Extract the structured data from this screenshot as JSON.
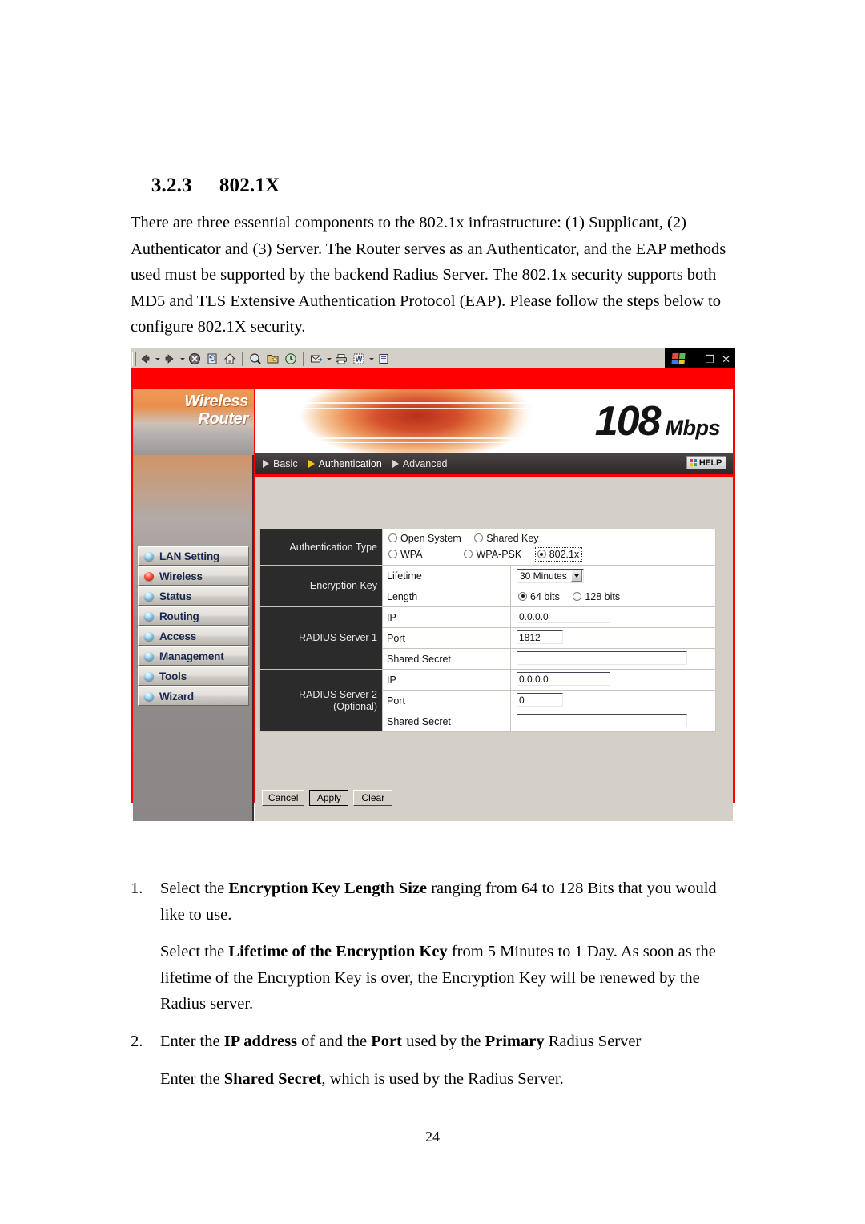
{
  "document": {
    "section_number": "3.2.3",
    "section_title": "802.1X",
    "intro": "There are three essential components to the 802.1x infrastructure: (1) Supplicant, (2) Authenticator and (3) Server.    The Router serves as an Authenticator, and the EAP methods used must be supported by the backend Radius Server.    The 802.1x security supports both MD5 and TLS Extensive Authentication Protocol (EAP). Please follow the steps below to configure 802.1X security.",
    "page_number": "24"
  },
  "steps": [
    {
      "marker": "1.",
      "para1_a": "Select the ",
      "para1_b": "Encryption Key Length Size",
      "para1_c": " ranging from 64 to 128 Bits that you would like to use.",
      "para2_a": "Select the ",
      "para2_b": "Lifetime of the Encryption Key",
      "para2_c": " from 5 Minutes to 1 Day.    As soon as the lifetime of the Encryption Key is over, the Encryption Key will be renewed by the Radius server."
    },
    {
      "marker": "2.",
      "para1_a": "Enter the ",
      "para1_b": "IP address",
      "para1_c": " of and the ",
      "para1_d": "Port",
      "para1_e": " used by the ",
      "para1_f": "Primary",
      "para1_g": " Radius Server",
      "para2_a": "Enter the ",
      "para2_b": "Shared Secret",
      "para2_c": ", which is used by the Radius Server."
    }
  ],
  "screenshot": {
    "browser": {
      "toolbar_icons": [
        "back-icon",
        "back-dropdown-icon",
        "forward-icon",
        "forward-dropdown-icon",
        "stop-icon",
        "refresh-icon",
        "home-icon",
        "search-icon",
        "favorites-icon",
        "history-icon",
        "mail-icon",
        "mail-dropdown-icon",
        "print-icon",
        "edit-icon",
        "edit-dropdown-icon",
        "discuss-icon"
      ],
      "window_controls": {
        "app_icon": "windows-logo-icon",
        "minimize": "–",
        "restore": "❐",
        "close": "✕"
      }
    },
    "brand": {
      "line1": "Wireless",
      "line2": "Router",
      "speed_number": "108",
      "speed_unit": "Mbps"
    },
    "nav": {
      "tabs": [
        {
          "label": "Basic",
          "active": false
        },
        {
          "label": "Authentication",
          "active": true
        },
        {
          "label": "Advanced",
          "active": false
        }
      ],
      "help_label": "HELP"
    },
    "sidebar": {
      "items": [
        {
          "label": "LAN Setting",
          "active": false
        },
        {
          "label": "Wireless",
          "active": true
        },
        {
          "label": "Status",
          "active": false
        },
        {
          "label": "Routing",
          "active": false
        },
        {
          "label": "Access",
          "active": false
        },
        {
          "label": "Management",
          "active": false
        },
        {
          "label": "Tools",
          "active": false
        },
        {
          "label": "Wizard",
          "active": false
        }
      ]
    },
    "form": {
      "auth_type_label": "Authentication Type",
      "auth_options": [
        {
          "label": "Open System",
          "selected": false
        },
        {
          "label": "Shared Key",
          "selected": false
        },
        {
          "label": "WPA",
          "selected": false
        },
        {
          "label": "WPA-PSK",
          "selected": false
        },
        {
          "label": "802.1x",
          "selected": true
        }
      ],
      "encryption_key_label": "Encryption Key",
      "lifetime_label": "Lifetime",
      "lifetime_value": "30 Minutes",
      "length_label": "Length",
      "length_options": [
        {
          "label": "64 bits",
          "selected": true
        },
        {
          "label": "128 bits",
          "selected": false
        }
      ],
      "radius1_label": "RADIUS Server 1",
      "radius2_label_line1": "RADIUS Server 2",
      "radius2_label_line2": "(Optional)",
      "field_ip_label": "IP",
      "field_port_label": "Port",
      "field_secret_label": "Shared Secret",
      "radius1_ip": "0.0.0.0",
      "radius1_port": "1812",
      "radius1_secret": "",
      "radius2_ip": "0.0.0.0",
      "radius2_port": "0",
      "radius2_secret": "",
      "buttons": [
        {
          "label": "Cancel",
          "default": false
        },
        {
          "label": "Apply",
          "default": true
        },
        {
          "label": "Clear",
          "default": false
        }
      ]
    }
  }
}
